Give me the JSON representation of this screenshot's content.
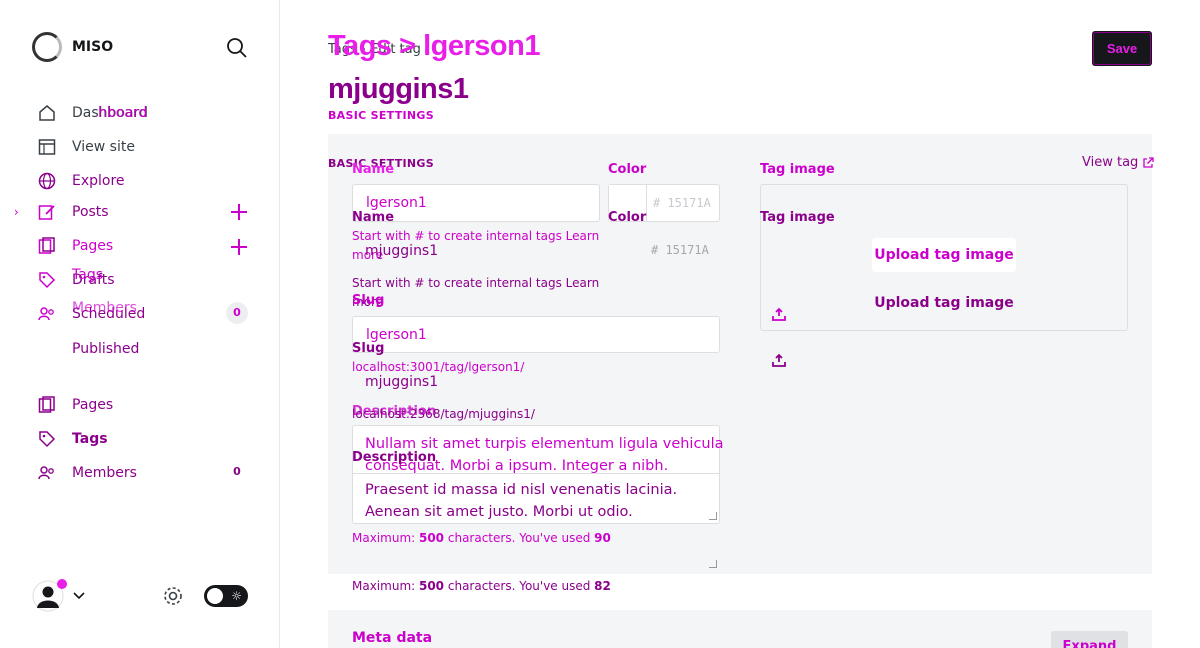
{
  "brand": {
    "name": "MISO",
    "name_ghost": "MISO"
  },
  "sidebar": {
    "nav": [
      {
        "label": "Dashboard",
        "ghost": "hboard",
        "icon": "home-icon"
      },
      {
        "label": "View site",
        "icon": "browser-icon"
      },
      {
        "label": "Explore",
        "icon": "globe-icon"
      },
      {
        "label": "Posts",
        "icon": "edit-icon"
      },
      {
        "label": "Pages",
        "ghost": "Drafts",
        "icon": "pages-icon"
      },
      {
        "label": "Tags",
        "ghost": "Drafts",
        "icon": "tag-icon"
      },
      {
        "label": "Members",
        "ghost": "Scheduled",
        "icon": "members-icon",
        "count": "0"
      },
      {
        "label": "Published"
      },
      {
        "label": "Pages",
        "icon": "pages-icon"
      },
      {
        "label": "Tags",
        "icon": "tag-icon"
      },
      {
        "label": "Members",
        "icon": "members-icon",
        "count": "0"
      }
    ]
  },
  "header": {
    "breadcrumb": "Tags  ›  Edit tag",
    "title_ghost": "Tags > lgerson1",
    "title": "mjuggins1",
    "save_label": "Save",
    "section_label": "BASIC SETTINGS"
  },
  "form": {
    "section_label": "BASIC SETTINGS",
    "name_label": "Name",
    "name_value_a": "lgerson1",
    "name_value_b": "mjuggins1",
    "name_hint": "Start with # to create internal tags Learn more",
    "color_label": "Color",
    "color_value": "# 15171A",
    "slug_label": "Slug",
    "slug_value_a": "lgerson1",
    "slug_value_b": "mjuggins1",
    "slug_url_a": "localhost:3001/tag/lgerson1/",
    "slug_url_b": "localhost:2368/tag/mjuggins1/",
    "description_label": "Description",
    "description_a_line1": "Nullam sit amet turpis elementum ligula vehicula",
    "description_a_line2": "consequat. Morbi a ipsum. Integer a nibh.",
    "description_b_line1": "Praesent id massa id nisl venenatis lacinia.",
    "description_b_line2": "Aenean sit amet justo. Morbi ut odio.",
    "max_a": {
      "prefix": "Maximum: ",
      "limit": "500",
      "mid": " characters. You've used ",
      "used": "90"
    },
    "max_b": {
      "prefix": "Maximum: ",
      "limit": "500",
      "mid": " characters. You've used ",
      "used": "82"
    },
    "tag_image_label": "Tag image",
    "view_tag_label": "View tag",
    "upload_label": "Upload tag image"
  },
  "meta": {
    "title": "Meta data",
    "expand_label": "Expand"
  },
  "colors": {
    "accent": "#e91ee9",
    "accent_dark": "#8b008b",
    "text": "#15171a",
    "panel": "#f4f5f6"
  }
}
